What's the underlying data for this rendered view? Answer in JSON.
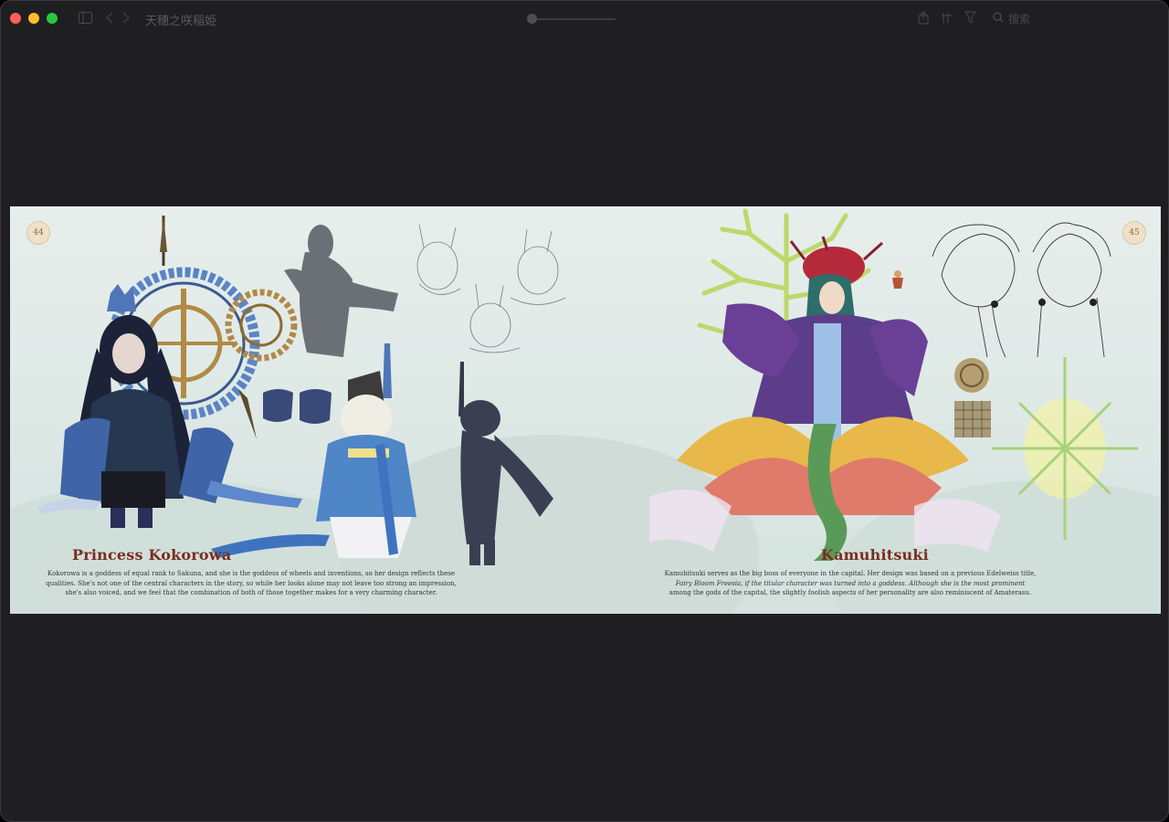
{
  "window": {
    "title": "天穂之咲稲姫",
    "search_label": "搜索"
  },
  "pages": {
    "left": {
      "number": "44",
      "heading": "Princess Kokorowa",
      "caption_lines": [
        "Kokorowa is a goddess of equal rank to Sakuna, and she is the goddess of wheels and inventions, so her design reflects these",
        "qualities. She's not one of the central characters in the story, so while her looks alone may not leave too strong an impression,",
        "she's also voiced, and we feel that the combination of both of those together makes for a very charming character."
      ]
    },
    "right": {
      "number": "45",
      "heading": "Kamuhitsuki",
      "caption_lines": [
        "Kamuhitsuki serves as the big boss of everyone in the capital. Her design was based on a previous Edelweiss title,",
        "Fairy Bloom Freesia, if the titular character was turned into a goddess. Although she is the most prominent",
        "among the gods of the capital, the slightly foolish aspects of her personality are also reminiscent of Amaterasu."
      ]
    }
  },
  "colors": {
    "window_bg": "#1f1f21",
    "page_bg": "#e3ebe8",
    "heading": "#7a2e1e"
  },
  "icons": [
    "sidebar-icon",
    "back-icon",
    "forward-icon",
    "share-icon",
    "markup-icon",
    "annotate-icon",
    "search-icon"
  ]
}
